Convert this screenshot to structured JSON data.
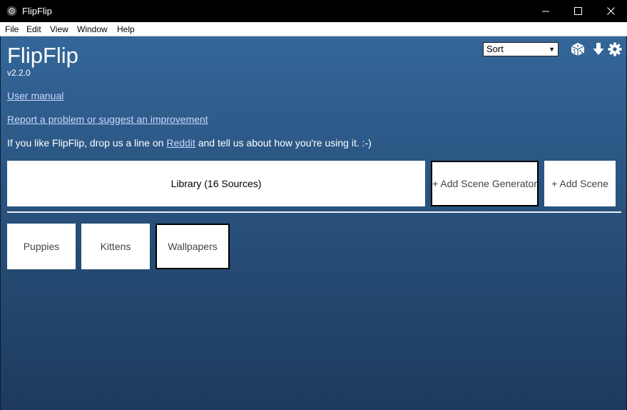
{
  "window": {
    "title": "FlipFlip"
  },
  "menu": [
    "File",
    "Edit",
    "View",
    "Window",
    "Help"
  ],
  "header": {
    "app_name": "FlipFlip",
    "version": "v2.2.0",
    "sort_label": "Sort",
    "icons": [
      "dice-icon",
      "download-icon",
      "gear-icon"
    ]
  },
  "links": {
    "manual": "User manual",
    "report": "Report a problem or suggest an improvement"
  },
  "blurb": {
    "before": "If you like FlipFlip, drop us a line on ",
    "link": "Reddit",
    "after": " and tell us about how you're using it. :-)"
  },
  "cards": {
    "library": "Library (16 Sources)",
    "add_generator": "+ Add Scene Generator",
    "add_scene": "+ Add Scene"
  },
  "scenes": [
    "Puppies",
    "Kittens",
    "Wallpapers"
  ],
  "colors": {
    "titlebar": "#000000",
    "content_top": "#346699",
    "content_bottom": "#1d3a5d",
    "link": "#c9d7ff"
  }
}
